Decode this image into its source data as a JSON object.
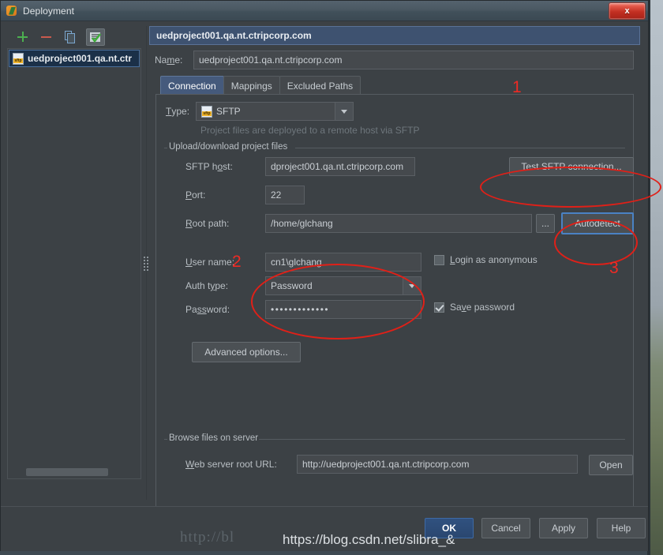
{
  "window": {
    "title": "Deployment",
    "icon": "pycharm-icon",
    "close_label": "x"
  },
  "sidebar": {
    "toolbar": [
      {
        "name": "add-icon",
        "label": "+"
      },
      {
        "name": "remove-icon",
        "label": "−"
      },
      {
        "name": "copy-icon",
        "label": ""
      },
      {
        "name": "set-default-icon",
        "label": ""
      }
    ],
    "items": [
      {
        "label": "uedproject001.qa.nt.ctr",
        "icon": "sftp-server-icon",
        "selected": true
      }
    ]
  },
  "main": {
    "header_title": "uedproject001.qa.nt.ctripcorp.com",
    "name_label": "Name:",
    "name_value": "uedproject001.qa.nt.ctripcorp.com",
    "tabs": [
      {
        "label": "Connection",
        "active": true
      },
      {
        "label": "Mappings",
        "active": false
      },
      {
        "label": "Excluded Paths",
        "active": false
      }
    ],
    "type_label": "Type:",
    "type_value": "SFTP",
    "type_hint": "Project files are deployed to a remote host via SFTP",
    "upload_group_title": "Upload/download project files",
    "fields": {
      "sftp_host_label": "SFTP host:",
      "sftp_host_value": "dproject001.qa.nt.ctripcorp.com",
      "port_label": "Port:",
      "port_value": "22",
      "root_path_label": "Root path:",
      "root_path_value": "/home/glchang",
      "browse_label": "...",
      "user_name_label": "User name:",
      "user_name_value": "cn1\\glchang",
      "auth_type_label": "Auth type:",
      "auth_type_value": "Password",
      "password_label": "Password:",
      "password_value": "•••••••••••••"
    },
    "checkboxes": {
      "login_anonymous_label": "Login as anonymous",
      "login_anonymous_checked": false,
      "save_password_label": "Save password",
      "save_password_checked": true
    },
    "buttons": {
      "test_connection": "Test SFTP connection...",
      "autodetect": "Autodetect",
      "advanced_options": "Advanced options..."
    },
    "browse_group_title": "Browse files on server",
    "web_root_label": "Web server root URL:",
    "web_root_value": "http://uedproject001.qa.nt.ctripcorp.com",
    "open_label": "Open"
  },
  "footer": {
    "ok": "OK",
    "cancel": "Cancel",
    "apply": "Apply",
    "help": "Help"
  },
  "annotations": {
    "marker_1": "1",
    "marker_2": "2",
    "marker_3": "3"
  },
  "watermarks": {
    "primary": "http://bl",
    "secondary": "https://blog.csdn.net/slibra_&"
  },
  "colors": {
    "accent_blue": "#3e5270",
    "annotation_red": "#e02018",
    "ok_button": "#30517f",
    "window_bg": "#3c4145"
  }
}
